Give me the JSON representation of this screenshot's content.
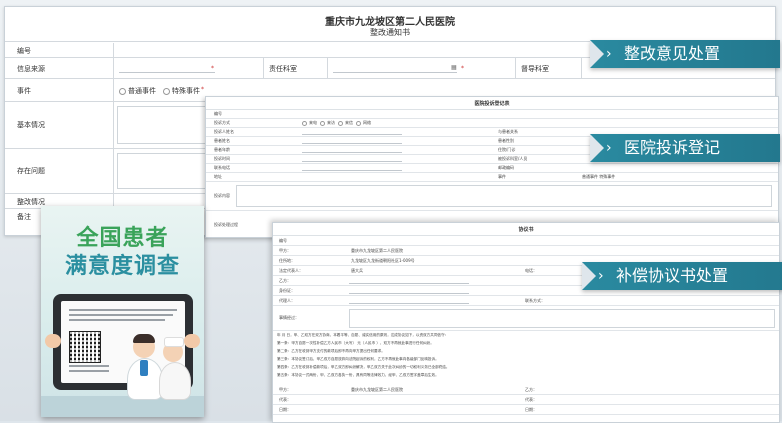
{
  "form1": {
    "hospital": "重庆市九龙坡区第二人民医院",
    "title": "整改通知书",
    "fields": {
      "number": "编号",
      "source": "信息来源",
      "responsible_dept": "责任科室",
      "supervise_dept": "督导科室",
      "event": "事件",
      "basic": "基本情况",
      "problem": "存在问题",
      "measures": "整改情况",
      "remark": "备注"
    },
    "event_options": [
      "普通事件",
      "特殊事件"
    ]
  },
  "form2": {
    "title": "医院投诉登记表",
    "fields": {
      "number": "编号",
      "method": "投诉方式",
      "person": "投诉人姓名",
      "patient_name": "患者姓名",
      "patient_age": "患者年龄",
      "time": "投诉时间",
      "phone": "联系电话",
      "address": "地址",
      "content": "投诉内容",
      "process": "投诉处理过程",
      "summary": "调查核实情况",
      "opinion": "医院处理意见",
      "result": "处理结果",
      "reception": "接待",
      "complainant": "投诉人",
      "relation": "与患者关系",
      "gender": "患者性别",
      "dept": "住院/门诊",
      "doctor": "被投诉科室/人员",
      "email": "邮政编码",
      "event": "事件",
      "event_opts": "普通事件  特殊事件"
    },
    "method_opts": [
      "来电",
      "来访",
      "来信",
      "网络"
    ]
  },
  "form3": {
    "title": "协议书",
    "fields": {
      "number": "编号",
      "party_a": "甲方：",
      "party_a_val": "重庆市九龙坡区第二人民医院",
      "addr": "住所地：",
      "addr_val": "九龙坡区九龙街道朝阳社区1-009号",
      "legal": "法定代表人：",
      "legal_val": "唐大兵",
      "party_b": "乙方：",
      "id": "身份证：",
      "agent": "代理人：",
      "phone": "电话：",
      "contact": "联系方式：",
      "reason": "事情经过：",
      "sign_a": "甲方：",
      "sign_a_val": "重庆市九龙坡区第二人民医院",
      "sign_b": "乙方：",
      "rep_a": "代表：",
      "rep_b": "代表：",
      "date_a": "日期：",
      "date_b": "日期："
    },
    "paras": [
      "年      月      日，甲、乙双方在双方协商，本着平等、自愿、诚实信用的原则，达成协议如下，以资双方共同信守：",
      "第一条：甲方自愿一次性补偿乙方人民币（大写）                元（人民币                    ），双方不再就此事进行任何纠纷。",
      "第二条：乙方在收到甲方支付的款项后即不再向甲方提出任何要求。",
      "第三条：本协议签订后，甲乙双方自愿放弃向法院起诉的权利，乙方不再就此事向各级部门反映投诉。",
      "第四条：乙方在收到补偿款项后，甲乙双方即纠纷解决，甲乙双方关于此次纠纷的一切权利义务已全部终结。",
      "第五条：本协议一式两份，甲、乙双方各执一份，具有同等法律效力，经甲、乙双方签字盖章后生效。"
    ]
  },
  "banners": [
    "整改意见处置",
    "医院投诉登记",
    "补偿协议书处置"
  ],
  "poster": {
    "line1": "全国患者",
    "line2": "满意度调查"
  }
}
